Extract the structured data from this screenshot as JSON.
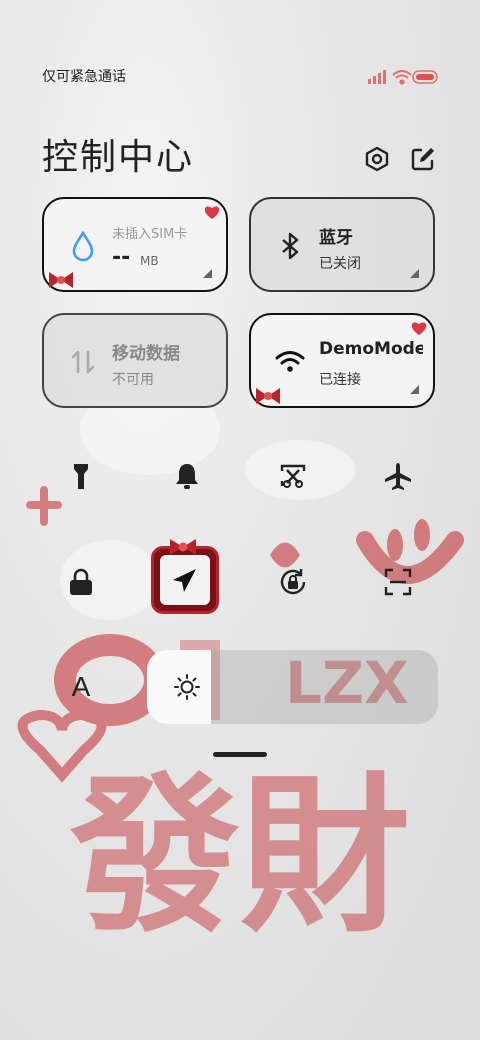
{
  "status": {
    "carrier": "仅可紧急通话"
  },
  "header": {
    "title": "控制中心"
  },
  "tiles": {
    "data_usage": {
      "label": "未插入SIM卡",
      "value": "--",
      "unit": "MB"
    },
    "bluetooth": {
      "label": "蓝牙",
      "status": "已关闭"
    },
    "mobile_data": {
      "label": "移动数据",
      "status": "不可用"
    },
    "wifi": {
      "label": "DemoMode",
      "status": "已连接"
    }
  },
  "toggles_row1": [
    "flashlight-icon",
    "bell-icon",
    "screenshot-icon",
    "airplane-icon"
  ],
  "toggles_row2": [
    "lock-icon",
    "location-icon",
    "rotation-lock-icon",
    "scan-icon"
  ],
  "brightness": {
    "label": "A",
    "level_percent": 22
  },
  "wallpaper_text": {
    "line1": "LZX",
    "line2": "發財"
  },
  "colors": {
    "accent_blue": "#3aa0f5",
    "wallpaper_red": "#c2282e"
  }
}
